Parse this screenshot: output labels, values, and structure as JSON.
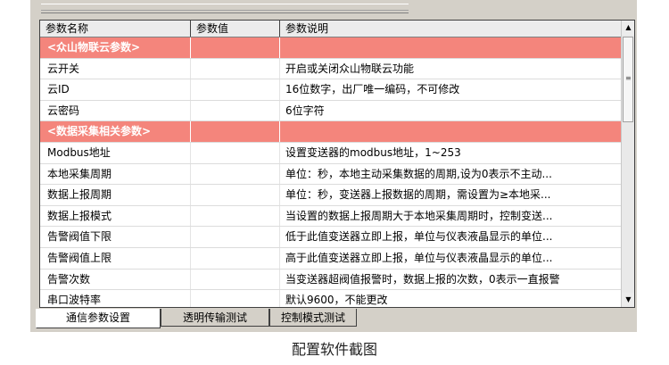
{
  "grid": {
    "columns": [
      "参数名称",
      "参数值",
      "参数说明"
    ],
    "rows": [
      {
        "name": "<众山物联云参数>",
        "value": "",
        "desc": "",
        "section": true
      },
      {
        "name": "云开关",
        "value": "",
        "desc": "开启或关闭众山物联云功能"
      },
      {
        "name": "云ID",
        "value": "",
        "desc": "16位数字，出厂唯一编码，不可修改"
      },
      {
        "name": "云密码",
        "value": "",
        "desc": "6位字符"
      },
      {
        "name": "<数据采集相关参数>",
        "value": "",
        "desc": "",
        "section": true
      },
      {
        "name": "Modbus地址",
        "value": "",
        "desc": "设置变送器的modbus地址，1~253"
      },
      {
        "name": "本地采集周期",
        "value": "",
        "desc": "单位：秒，本地主动采集数据的周期,设为0表示不主动..."
      },
      {
        "name": "数据上报周期",
        "value": "",
        "desc": "单位：秒，变送器上报数据的周期，需设置为≥本地采..."
      },
      {
        "name": "数据上报模式",
        "value": "",
        "desc": "当设置的数据上报周期大于本地采集周期时，控制变送..."
      },
      {
        "name": "告警阀值下限",
        "value": "",
        "desc": "低于此值变送器立即上报，单位与仪表液晶显示的单位..."
      },
      {
        "name": "告警阀值上限",
        "value": "",
        "desc": "高于此值变送器立即上报，单位与仪表液晶显示的单位..."
      },
      {
        "name": "告警次数",
        "value": "",
        "desc": "当变送器超阀值报警时，数据上报的次数，0表示一直报警"
      },
      {
        "name": "串口波特率",
        "value": "",
        "desc": "默认9600，不能更改"
      }
    ]
  },
  "tabs": [
    {
      "label": "通信参数设置",
      "active": true
    },
    {
      "label": "透明传输测试",
      "active": false
    },
    {
      "label": "控制模式测试",
      "active": false
    }
  ],
  "caption": "配置软件截图",
  "colors": {
    "section_bg": "#f4857c"
  }
}
